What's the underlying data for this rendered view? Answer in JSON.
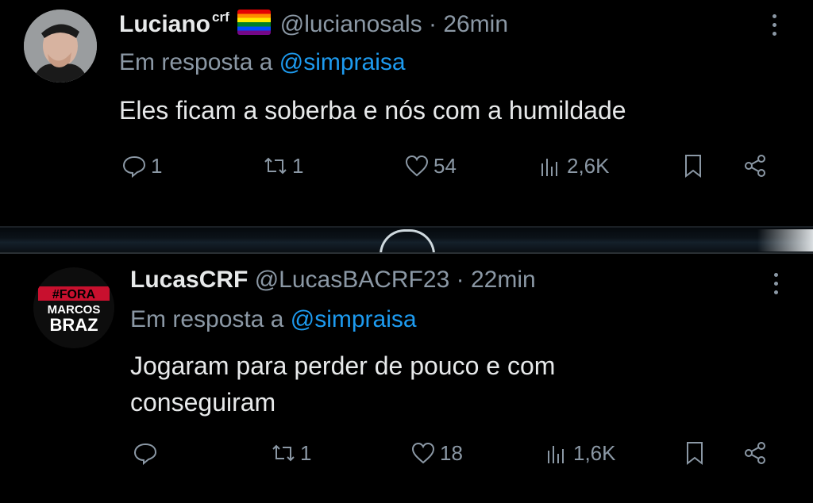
{
  "tweets": [
    {
      "display_name": "Luciano",
      "name_superscript": "crf",
      "handle": "@lucianosals",
      "separator": "·",
      "time": "26min",
      "reply_label": "Em resposta a",
      "reply_mention": "@simpraisa",
      "text": "Eles ficam  a soberba e nós com a humildade",
      "reply_count": "1",
      "retweet_count": "1",
      "like_count": "54",
      "view_count": "2,6K"
    },
    {
      "display_name": "LucasCRF",
      "handle": "@LucasBACRF23",
      "separator": "·",
      "time": "22min",
      "reply_label": "Em resposta a",
      "reply_mention": "@simpraisa",
      "text": "Jogaram para perder de pouco e com conseguiram",
      "avatar_text": {
        "line1": "#FORA",
        "line2": "MARCOS",
        "line3": "BRAZ"
      },
      "reply_count": "",
      "retweet_count": "1",
      "like_count": "18",
      "view_count": "1,6K"
    }
  ],
  "icons": {
    "reply": "reply-bubble-icon",
    "retweet": "retweet-icon",
    "like": "heart-icon",
    "views": "views-bar-chart-icon",
    "bookmark": "bookmark-icon",
    "share": "share-icon",
    "more": "more-vertical-icon",
    "flag": "rainbow-flag-emoji"
  },
  "colors": {
    "background": "#000000",
    "text": "#e7e9ea",
    "muted": "#8b98a5",
    "mention": "#1d9bf0"
  }
}
